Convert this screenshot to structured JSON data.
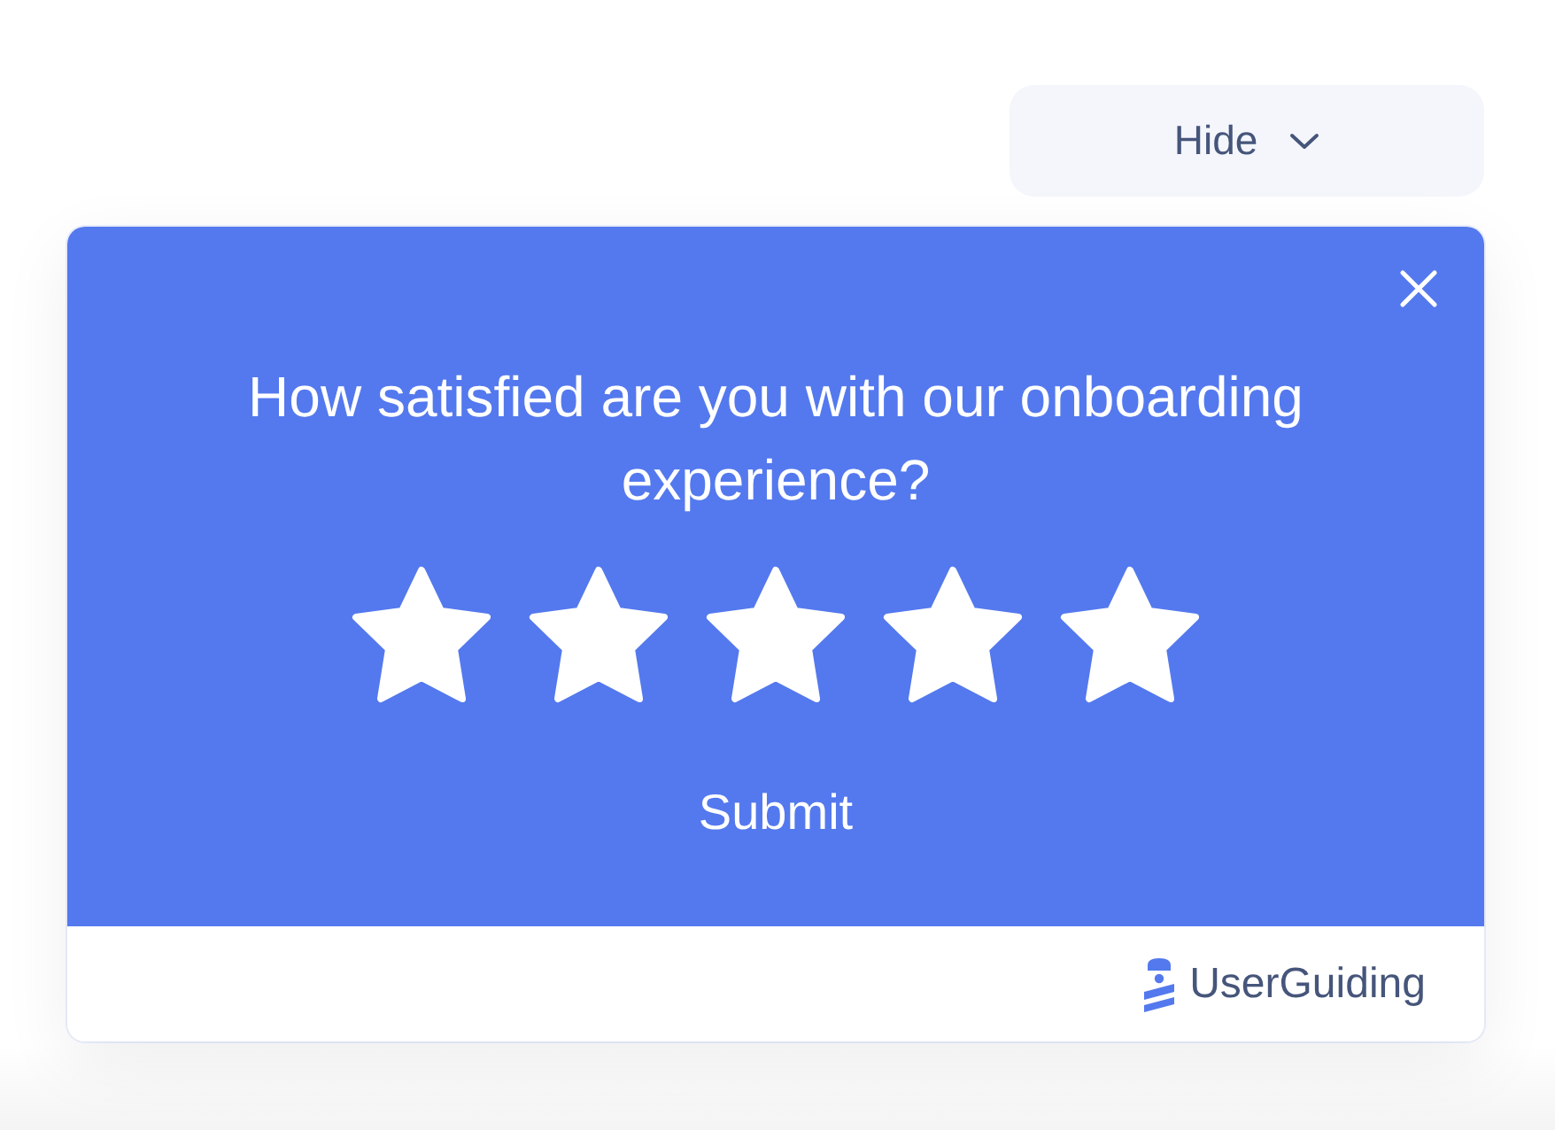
{
  "hide_button": {
    "label": "Hide"
  },
  "survey": {
    "question": "How satisfied are you with our onboarding experience?",
    "rating": {
      "stars": 5
    },
    "submit": "Submit"
  },
  "footer": {
    "brand": "UserGuiding"
  }
}
